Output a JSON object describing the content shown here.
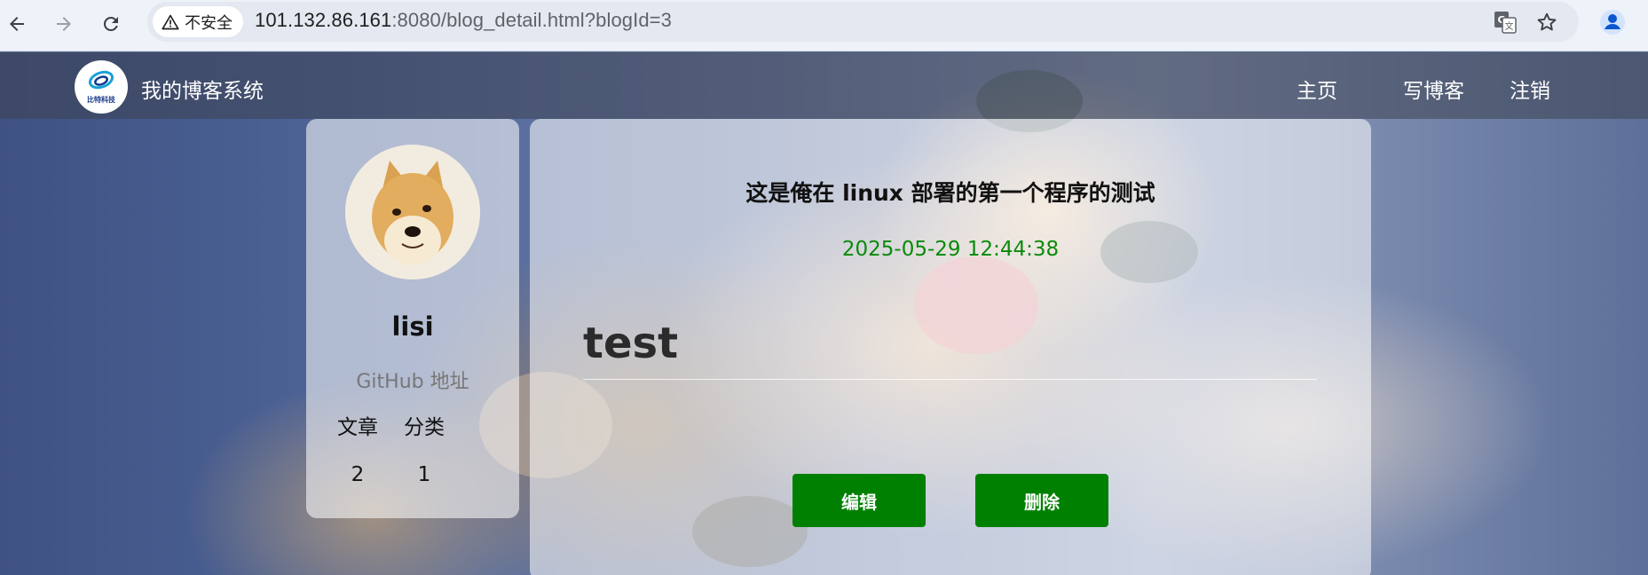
{
  "browser": {
    "security_label": "不安全",
    "url_host": "101.132.86.161",
    "url_rest": ":8080/blog_detail.html?blogId=3",
    "icons": [
      "back-icon",
      "forward-icon",
      "reload-icon",
      "warning-icon",
      "translate-icon",
      "star-icon",
      "profile-icon"
    ]
  },
  "site": {
    "logo_text": "比特科技",
    "title": "我的博客系统",
    "nav": {
      "home": "主页",
      "write": "写博客",
      "logout": "注销"
    }
  },
  "profile": {
    "name": "lisi",
    "github_label": "GitHub 地址",
    "stats": {
      "articles_label": "文章",
      "categories_label": "分类",
      "articles_count": "2",
      "categories_count": "1"
    }
  },
  "blog": {
    "title": "这是俺在 linux 部署的第一个程序的测试",
    "date": "2025-05-29 12:44:38",
    "content": "test",
    "edit_label": "编辑",
    "delete_label": "删除"
  },
  "colors": {
    "accent_green": "#008000",
    "date_green": "#0a8a0a",
    "nav_overlay": "rgba(60,66,80,0.55)"
  }
}
